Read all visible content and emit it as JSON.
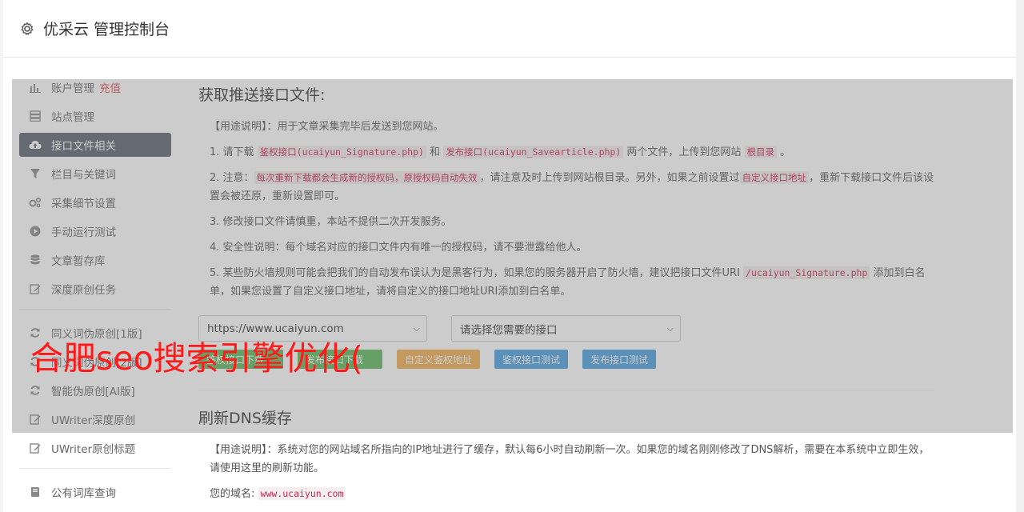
{
  "header": {
    "title": "优采云 管理控制台",
    "icon": "gear-icon"
  },
  "sidebar": {
    "items": [
      {
        "label": "账户管理",
        "tag": "充值",
        "icon": "bar-chart-icon"
      },
      {
        "label": "站点管理",
        "icon": "server-icon"
      },
      {
        "label": "接口文件相关",
        "icon": "cloud-upload-icon",
        "active": true
      },
      {
        "label": "栏目与关键词",
        "icon": "filter-icon"
      },
      {
        "label": "采集细节设置",
        "icon": "cogs-icon"
      },
      {
        "label": "手动运行测试",
        "icon": "play-icon"
      },
      {
        "label": "文章暂存库",
        "icon": "database-icon"
      },
      {
        "label": "深度原创任务",
        "icon": "edit-icon"
      }
    ],
    "items2": [
      {
        "label": "同义词伪原创[1版]",
        "icon": "refresh-icon"
      },
      {
        "label": "同义词伪原创[2版]",
        "icon": "refresh-icon"
      },
      {
        "label": "智能伪原创[AI版]",
        "icon": "refresh-icon"
      },
      {
        "label": "UWriter深度原创",
        "icon": "edit-icon"
      },
      {
        "label": "UWriter原创标题",
        "icon": "edit-icon"
      }
    ],
    "items3": [
      {
        "label": "公有词库查询",
        "icon": "book-icon"
      }
    ]
  },
  "section1": {
    "title": "获取推送接口文件:",
    "usage": "【用途说明】：用于文章采集完毕后发送到您网站。",
    "p1_a": "1. 请下载 ",
    "p1_code1": "鉴权接口(ucaiyun_Signature.php)",
    "p1_b": " 和 ",
    "p1_code2": "发布接口(ucaiyun_Savearticle.php)",
    "p1_c": " 两个文件，上传到您网站 ",
    "p1_code3": "根目录",
    "p1_d": " 。",
    "p2_a": "2. 注意：",
    "p2_code1": "每次重新下载都会生成新的授权码，原授权码自动失效",
    "p2_b": "，请注意及时上传到网站根目录。另外，如果之前设置过",
    "p2_code2": "自定义接口地址",
    "p2_c": "，重新下载接口文件后该设置会被还原，重新设置即可。",
    "p3": "3. 修改接口文件请慎重，本站不提供二次开发服务。",
    "p4": "4. 安全性说明：每个域名对应的接口文件内有唯一的授权码，请不要泄露给他人。",
    "p5_a": "5. 某些防火墙规则可能会把我们的自动发布误认为是黑客行为，如果您的服务器开启了防火墙，建议把接口文件URI ",
    "p5_code": "/ucaiyun_Signature.php",
    "p5_b": " 添加到白名单，如果您设置了自定义接口地址，请将自定义的接口地址URI添加到白名单。",
    "select_site": "https://www.ucaiyun.com",
    "select_api": "请选择您需要的接口",
    "btn1": "鉴权接口下载",
    "btn2": "发布接口下载",
    "btn3": "自定义鉴权地址",
    "btn4": "鉴权接口测试",
    "btn5": "发布接口测试"
  },
  "section2": {
    "title": "刷新DNS缓存",
    "usage": "【用途说明】：系统对您的网站域名所指向的IP地址进行了缓存，默认每6小时自动刷新一次。如果您的域名刚刚修改了DNS解析，需要在本系统中立即生效，请使用这里的刷新功能。",
    "domain_label": "您的域名:",
    "domain_value": "www.ucaiyun.com"
  },
  "watermark": "合肥seo搜索引擎优化("
}
